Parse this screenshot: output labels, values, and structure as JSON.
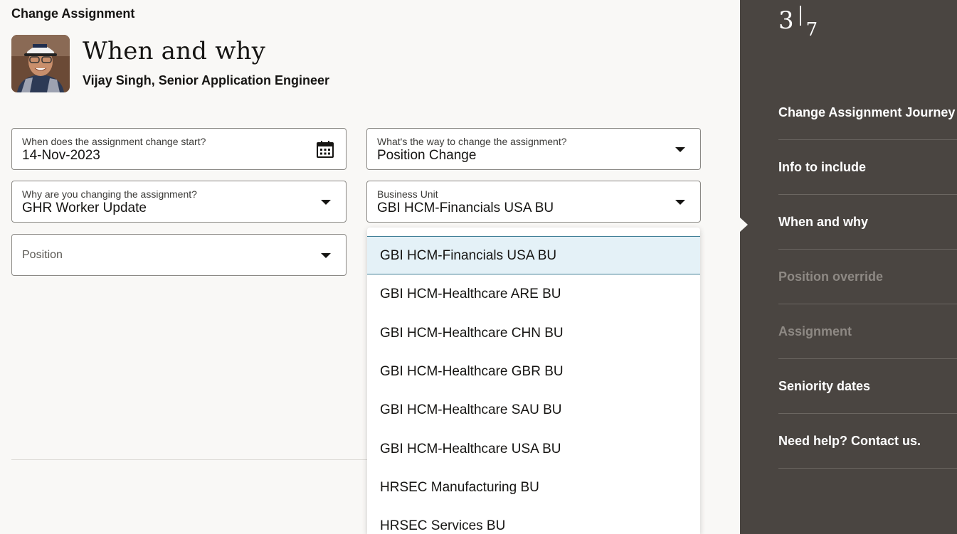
{
  "page": {
    "title": "Change Assignment",
    "heading": "When and why",
    "subheading": "Vijay Singh, Senior Application Engineer"
  },
  "form": {
    "start_date": {
      "label": "When does the assignment change start?",
      "value": "14-Nov-2023",
      "icon": "calendar-icon"
    },
    "change_way": {
      "label": "What's the way to change the assignment?",
      "value": "Position Change"
    },
    "reason": {
      "label": "Why are you changing the assignment?",
      "value": "GHR Worker Update"
    },
    "business_unit": {
      "label": "Business Unit",
      "value": "GBI HCM-Financials USA BU"
    },
    "position": {
      "placeholder": "Position"
    }
  },
  "dropdown": {
    "options": [
      "GBI HCM-Financials USA BU",
      "GBI HCM-Healthcare ARE BU",
      "GBI HCM-Healthcare CHN BU",
      "GBI HCM-Healthcare GBR BU",
      "GBI HCM-Healthcare SAU BU",
      "GBI HCM-Healthcare USA BU",
      "HRSEC Manufacturing BU",
      "HRSEC Services BU"
    ],
    "selected_index": 0
  },
  "sidebar": {
    "current_step": "3",
    "total_steps": "7",
    "items": [
      {
        "label": "Change Assignment Journey",
        "disabled": false
      },
      {
        "label": "Info to include",
        "disabled": false
      },
      {
        "label": "When and why",
        "disabled": false,
        "current": true
      },
      {
        "label": "Position override",
        "disabled": true
      },
      {
        "label": "Assignment",
        "disabled": true
      },
      {
        "label": "Seniority dates",
        "disabled": false
      },
      {
        "label": "Need help? Contact us.",
        "disabled": false
      }
    ]
  },
  "colors": {
    "sidebar_bg": "#4a4541",
    "page_bg": "#f9f8f6",
    "selected_option_bg": "#e4f1f7",
    "selected_option_border": "#3f7e96"
  }
}
